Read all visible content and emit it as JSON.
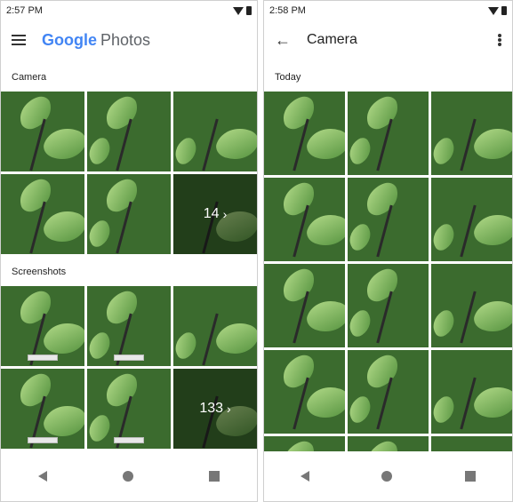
{
  "left_phone": {
    "status_time": "2:57 PM",
    "app_logo_google": "Google",
    "app_logo_photos": "Photos",
    "sections": [
      {
        "title": "Camera",
        "more_count": "14"
      },
      {
        "title": "Screenshots",
        "more_count": "133"
      }
    ]
  },
  "right_phone": {
    "status_time": "2:58 PM",
    "title": "Camera",
    "section": "Today"
  },
  "icons": [
    "wifi-icon",
    "battery-icon",
    "menu-icon",
    "back-arrow-icon",
    "more-vert-icon",
    "nav-back-icon",
    "nav-home-icon",
    "nav-recents-icon",
    "chevron-right-icon"
  ],
  "colors": {
    "text_primary": "#222222",
    "overlay": "#000000"
  }
}
